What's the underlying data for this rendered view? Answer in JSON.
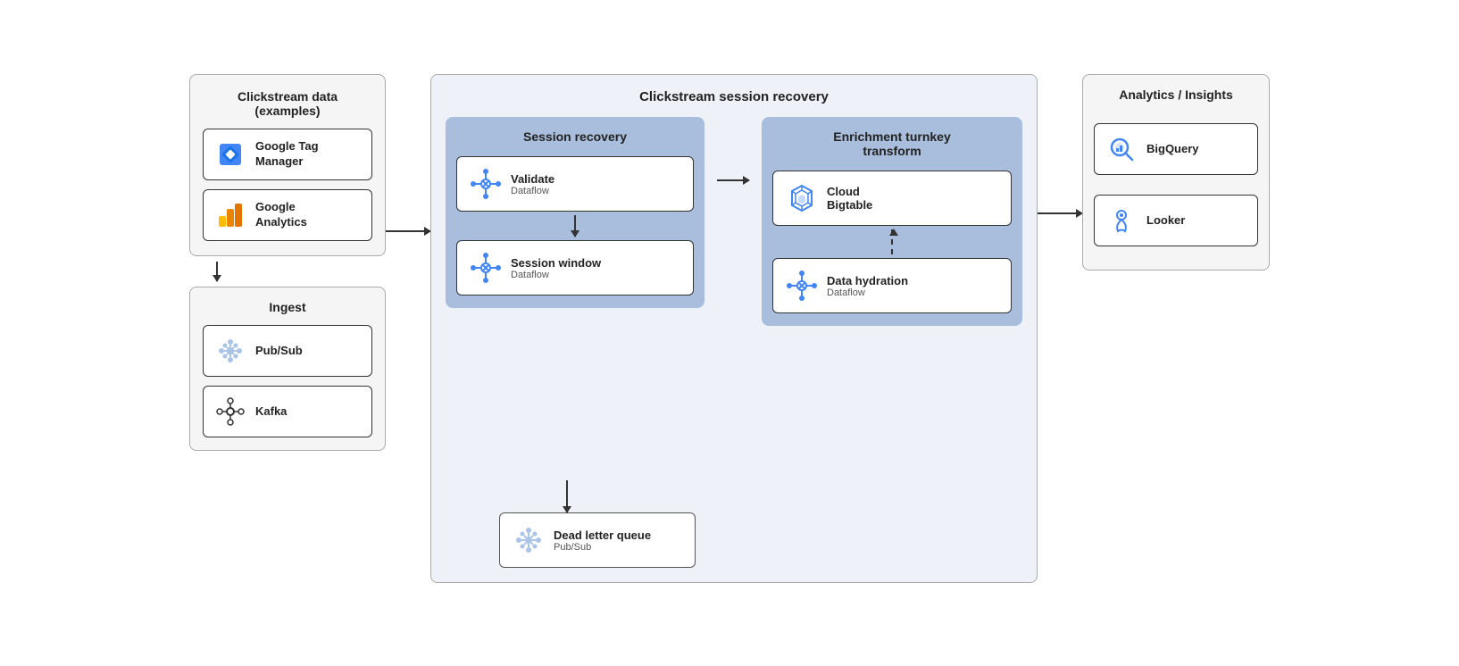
{
  "clickstream": {
    "title": "Clickstream data\n(examples)",
    "services": [
      {
        "id": "gtm",
        "label": "Google Tag\nManager",
        "label2": ""
      },
      {
        "id": "ga",
        "label": "Google\nAnalytics",
        "label2": ""
      }
    ]
  },
  "ingest": {
    "title": "Ingest",
    "services": [
      {
        "id": "pubsub1",
        "label": "Pub/Sub"
      },
      {
        "id": "kafka",
        "label": "Kafka"
      }
    ]
  },
  "sessionRecovery": {
    "outerTitle": "Clickstream session recovery",
    "innerTitle": "Session recovery",
    "validate": {
      "main": "Validate",
      "sub": "Dataflow"
    },
    "sessionWindow": {
      "main": "Session window",
      "sub": "Dataflow"
    }
  },
  "enrichment": {
    "title": "Enrichment turnkey\ntransform",
    "cloudBigtable": {
      "main": "Cloud\nBigtable",
      "sub": ""
    },
    "dataHydration": {
      "main": "Data hydration",
      "sub": "Dataflow"
    }
  },
  "dlq": {
    "main": "Dead letter queue",
    "sub": "Pub/Sub"
  },
  "analytics": {
    "title": "Analytics / Insights",
    "services": [
      {
        "id": "bigquery",
        "label": "BigQuery"
      },
      {
        "id": "looker",
        "label": "Looker"
      }
    ]
  }
}
